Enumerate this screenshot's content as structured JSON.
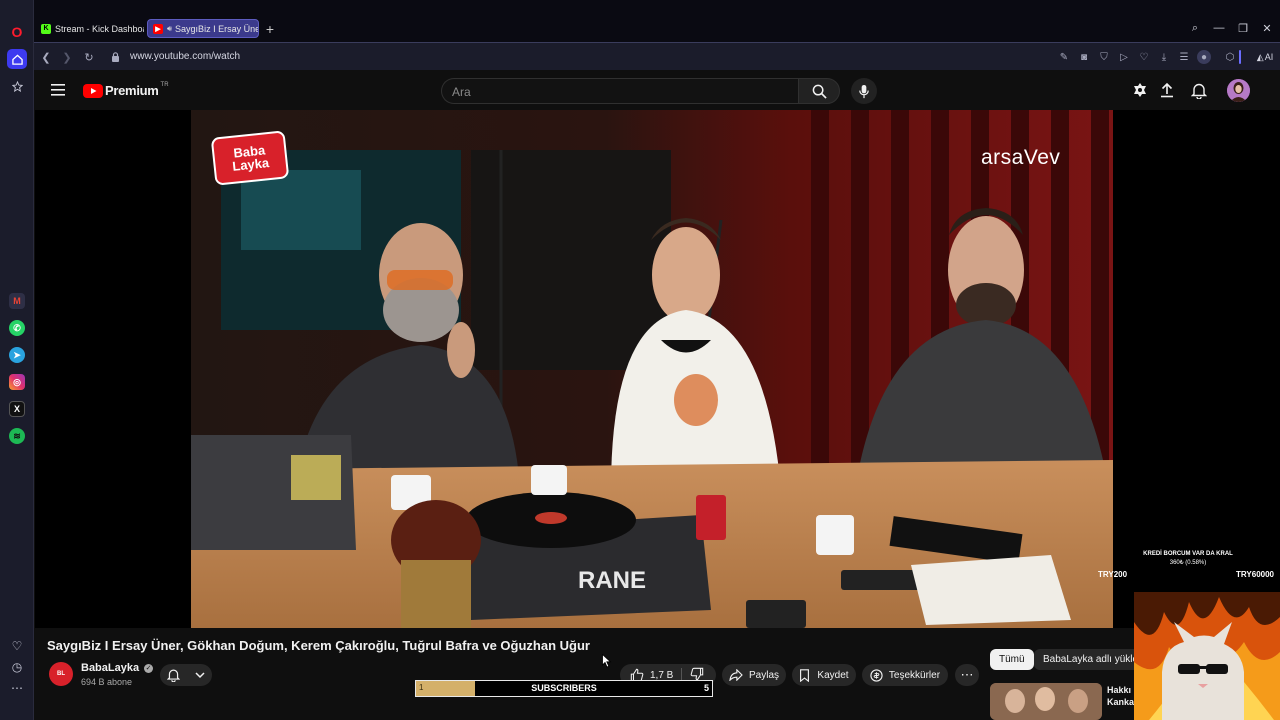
{
  "browser": {
    "tabs": [
      {
        "title": "Stream - Kick Dashboard",
        "favicon": "kick-icon",
        "active": false
      },
      {
        "title": "SaygıBiz I Ersay Üner,",
        "favicon": "youtube-icon",
        "active": true
      }
    ],
    "url": "www.youtube.com/watch",
    "aria_label": "Aria AI"
  },
  "sidebar_apps": [
    "gmail-icon",
    "whatsapp-icon",
    "telegram-icon",
    "instagram-icon",
    "x-icon",
    "spotify-icon"
  ],
  "youtube": {
    "logo_text": "Premium",
    "region": "TR",
    "search_placeholder": "Ara"
  },
  "video": {
    "brand_logo": "Baba Layka",
    "sponsor_logo": "arsaVev",
    "turntable_brand": "RANE",
    "title": "SaygıBiz I Ersay Üner, Gökhan Doğum, Kerem Çakıroğlu, Tuğrul Bafra ve Oğuzhan Uğur"
  },
  "channel": {
    "name": "BabaLayka",
    "verified": true,
    "subscribers": "694 B abone"
  },
  "actions": {
    "likes": "1,7 B",
    "share": "Paylaş",
    "save": "Kaydet",
    "thanks": "Teşekkürler"
  },
  "chips": {
    "all": "Tümü",
    "uploads": "BabaLayka adlı yükley"
  },
  "related": {
    "title_partial": "Hakkı",
    "title_partial_2": "Kanka"
  },
  "overlays": {
    "subscribers_label": "SUBSCRIBERS",
    "subscribers_current": "1",
    "subscribers_goal": "5",
    "subscribers_progress": 0.2,
    "donation_title": "KREDİ BORCUM VAR DA KRAL",
    "donation_progress_text": "360₺ (0.58%)",
    "donation_min": "TRY200",
    "donation_max": "TRY60000"
  },
  "colors": {
    "youtube_red": "#ff0000",
    "progress_gold": "#d4b06a",
    "sidebar_bg": "#1b1c2b"
  }
}
